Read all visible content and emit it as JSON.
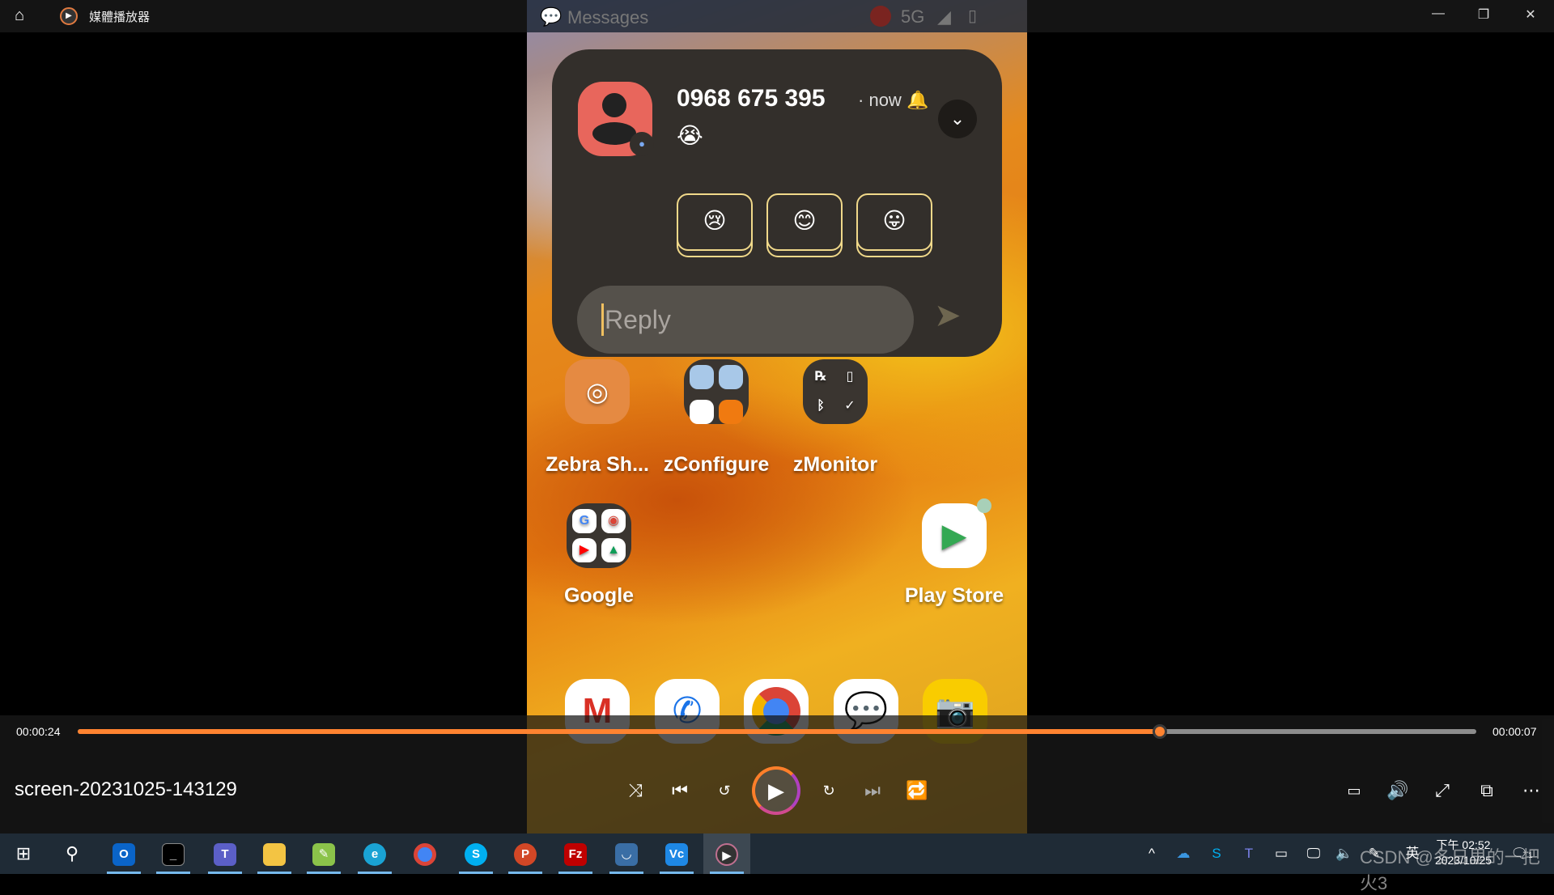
{
  "window": {
    "title": "媒體播放器",
    "icons": [
      "home-icon",
      "media-player-icon"
    ],
    "controls": [
      "minimize",
      "restore",
      "close"
    ]
  },
  "phone": {
    "status": {
      "app": "Messages",
      "network": "5G"
    },
    "notification": {
      "sender": "0968 675 395",
      "overlap_text": "Messages",
      "time": "now",
      "message": "😭",
      "reactions": [
        "😢",
        "😊",
        "😛"
      ],
      "reply_placeholder": "Reply"
    },
    "apps": [
      {
        "label": "Zebra Sh..."
      },
      {
        "label": "zConfigure"
      },
      {
        "label": "zMonitor"
      },
      {
        "label": "Google"
      },
      {
        "label": "Play Store"
      }
    ],
    "dock": [
      "gmail",
      "phone",
      "chrome",
      "messages",
      "camera"
    ]
  },
  "player": {
    "elapsed": "00:00:24",
    "remaining": "00:00:07",
    "progress_percent": 77.4,
    "file_title": "screen-20231025-143129",
    "accent": "#ff8330"
  },
  "taskbar": {
    "apps": [
      "windows-start",
      "search",
      "outlook",
      "terminal",
      "teams",
      "file-explorer",
      "notepad",
      "edge",
      "chrome",
      "skype",
      "powerpoint",
      "filezilla",
      "app",
      "vnc-viewer",
      "media-player"
    ],
    "ime": "英",
    "time": "下午 02:52",
    "date": "2023/10/25",
    "watermark": "CSDN @冬日里的一把火3",
    "notification_count": "1"
  }
}
